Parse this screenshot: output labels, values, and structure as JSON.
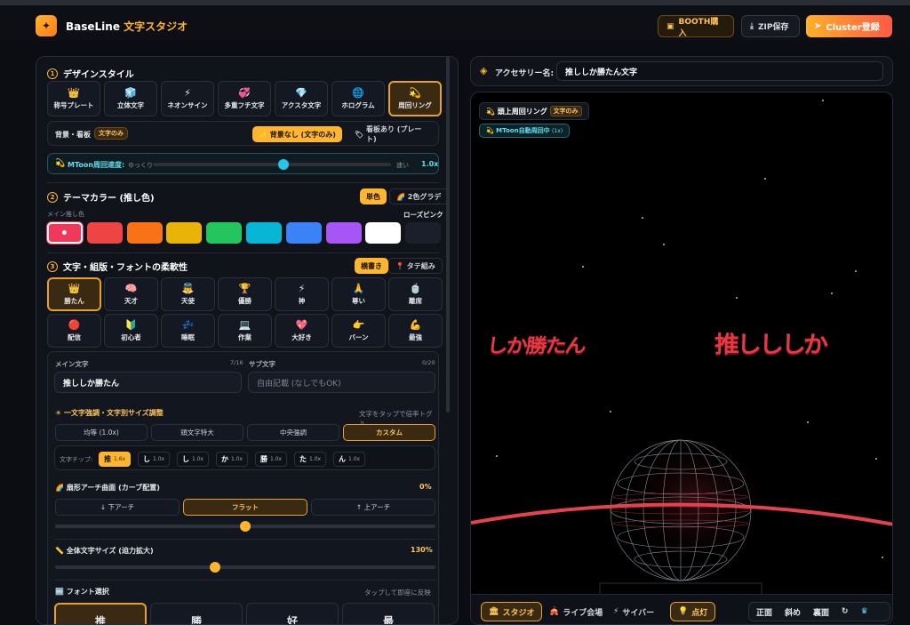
{
  "app": {
    "brand_en": "BaseLine",
    "brand_jp": "文字スタジオ",
    "logo_icon": "sparkle-icon"
  },
  "header": {
    "booth": "BOOTH購入",
    "zip": "ZIP保存",
    "cluster": "Cluster登録"
  },
  "sec1": {
    "num": "1",
    "title": "デザインスタイル",
    "styles": [
      {
        "label": "称号プレート",
        "icon": "👑"
      },
      {
        "label": "立体文字",
        "icon": "🧊"
      },
      {
        "label": "ネオンサイン",
        "icon": "⚡"
      },
      {
        "label": "多重フチ文字",
        "icon": "💞"
      },
      {
        "label": "アクスタ文字",
        "icon": "💎"
      },
      {
        "label": "ホログラム",
        "icon": "🌐"
      },
      {
        "label": "周回リング",
        "icon": "💫"
      }
    ],
    "bg_label": "背景・看板",
    "bg_mode": "文字のみ",
    "bg_opt1": "背景なし (文字のみ)",
    "bg_opt2": "看板あり (プレート)",
    "mtoon_label": "MToon周回速度:",
    "slow": "ゆっくり",
    "fast": "速い",
    "speed": "1.0x",
    "speed_fraction": 0.55
  },
  "sec2": {
    "num": "2",
    "title": "テーマカラー (推し色)",
    "single": "単色",
    "gradient": "2色グラデ",
    "main_label": "メイン推し色",
    "selected_name": "ローズピンク",
    "colors": [
      "#f2385a",
      "#ef4444",
      "#f97316",
      "#eab308",
      "#22c55e",
      "#06b6d4",
      "#3b82f6",
      "#a855f7",
      "#ffffff",
      "#1a1f2b"
    ]
  },
  "sec3": {
    "num": "3",
    "title": "文字・組版・フォントの柔軟性",
    "horizontal": "横書き",
    "vertical": "タテ組み",
    "presets": [
      {
        "label": "勝たん",
        "icon": "👑"
      },
      {
        "label": "天才",
        "icon": "🧠"
      },
      {
        "label": "天使",
        "icon": "👼"
      },
      {
        "label": "優勝",
        "icon": "🏆"
      },
      {
        "label": "神",
        "icon": "⚡"
      },
      {
        "label": "尊い",
        "icon": "🙏"
      },
      {
        "label": "離席",
        "icon": "🍵"
      },
      {
        "label": "配信",
        "icon": "🔴"
      },
      {
        "label": "初心者",
        "icon": "🔰"
      },
      {
        "label": "睡眠",
        "icon": "💤"
      },
      {
        "label": "作業",
        "icon": "💻"
      },
      {
        "label": "大好き",
        "icon": "💖"
      },
      {
        "label": "バーン",
        "icon": "👉"
      },
      {
        "label": "最強",
        "icon": "💪"
      }
    ],
    "main_text_label": "メイン文字",
    "main_count": "7/16",
    "main_text": "推ししか勝たん",
    "sub_text_label": "サブ文字",
    "sub_count": "0/20",
    "sub_placeholder": "自由記載 (なしでもOK)",
    "emph_title": "一文字強調・文字別サイズ調整",
    "emph_hint": "文字をタップで倍率トグル",
    "emph_tabs": [
      "均等 (1.0x)",
      "頭文字特大",
      "中央強調",
      "カスタム"
    ],
    "chip_label": "文字チップ:",
    "chips": [
      {
        "ch": "推",
        "m": "1.6x"
      },
      {
        "ch": "し",
        "m": "1.0x"
      },
      {
        "ch": "し",
        "m": "1.0x"
      },
      {
        "ch": "か",
        "m": "1.0x"
      },
      {
        "ch": "勝",
        "m": "1.0x"
      },
      {
        "ch": "た",
        "m": "1.0x"
      },
      {
        "ch": "ん",
        "m": "1.0x"
      }
    ],
    "arch_title": "扇形アーチ曲面 (カーブ配置)",
    "arch_value": "0%",
    "arch_tabs": [
      "↓ 下アーチ",
      "フラット",
      "↑ 上アーチ"
    ],
    "arch_fraction": 0.5,
    "size_title": "全体文字サイズ (迫力拡大)",
    "size_value": "130%",
    "size_fraction": 0.42,
    "font_title": "フォント選択",
    "font_hint": "タップして即座に反映",
    "fonts": [
      "推",
      "勝",
      "好",
      "最"
    ]
  },
  "accessory": {
    "label": "アクセサリー名:",
    "value": "推ししか勝たん文字",
    "icon": "layers-icon"
  },
  "preview": {
    "mode": "頭上周回リング",
    "badge": "文字のみ",
    "status": "MToon自動周回中",
    "status_speed": "(1x)",
    "text_left": "しか勝たん",
    "text_right": "推しししか",
    "tabs": [
      "スタジオ",
      "ライブ会場",
      "サイバー"
    ],
    "light": "点灯",
    "views": [
      "正面",
      "斜め",
      "裏面"
    ]
  }
}
